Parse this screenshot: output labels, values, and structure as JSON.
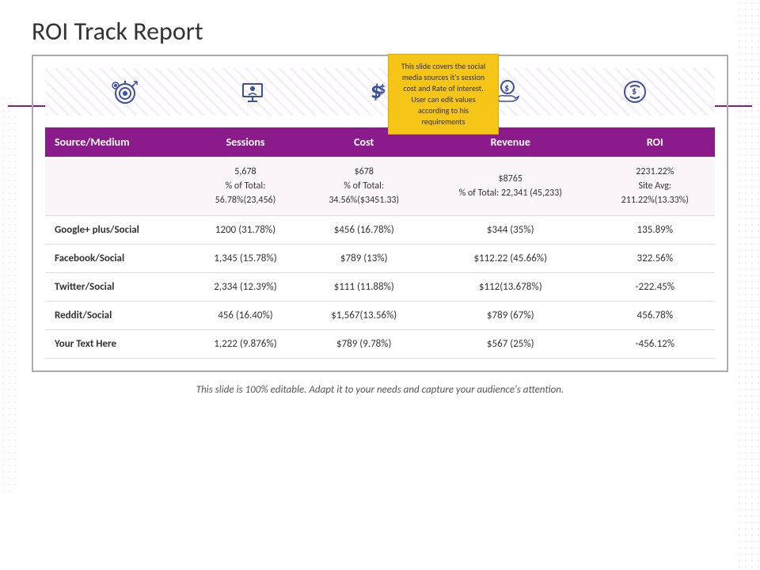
{
  "page": {
    "title": "ROI Track Report",
    "bottom_text": "This slide is 100% editable. Adapt it to your needs and capture your audience's attention."
  },
  "tooltip": {
    "text": "This slide covers the social media sources it's session cost and Rate of interest. User can edit values according to his requirements"
  },
  "icons": [
    {
      "name": "target-icon",
      "label": "Target"
    },
    {
      "name": "presentation-icon",
      "label": "Presentation"
    },
    {
      "name": "cost-icon",
      "label": "Cost"
    },
    {
      "name": "hand-coin-icon",
      "label": "Revenue"
    },
    {
      "name": "roi-icon",
      "label": "ROI"
    }
  ],
  "table": {
    "headers": [
      "Source/Medium",
      "Sessions",
      "Cost",
      "Revenue",
      "ROI"
    ],
    "rows": [
      {
        "source": "",
        "sessions": "5,678\n% of Total:\n56.78%(23,456)",
        "cost": "$678\n% of Total:\n34.56%($3451.33)",
        "revenue": "$8765\n% of Total: 22,341 (45,233)",
        "roi": "2231.22%\nSite Avg:\n211.22%(13.33%)"
      },
      {
        "source": "Google+ plus/Social",
        "sessions": "1200 (31.78%)",
        "cost": "$456 (16.78%)",
        "revenue": "$344 (35%)",
        "roi": "135.89%"
      },
      {
        "source": "Facebook/Social",
        "sessions": "1,345 (15.78%)",
        "cost": "$789 (13%)",
        "revenue": "$112.22 (45.66%)",
        "roi": "322.56%"
      },
      {
        "source": "Twitter/Social",
        "sessions": "2,334 (12.39%)",
        "cost": "$111 (11.88%)",
        "revenue": "$112(13.678%)",
        "roi": "-222.45%"
      },
      {
        "source": "Reddit/Social",
        "sessions": "456 (16.40%)",
        "cost": "$1,567(13.56%)",
        "revenue": "$789 (67%)",
        "roi": "456.78%"
      },
      {
        "source": "Your Text Here",
        "sessions": "1,222 (9.876%)",
        "cost": "$789 (9.78%)",
        "revenue": "$567 (25%)",
        "roi": "-456.12%"
      }
    ]
  },
  "colors": {
    "header_bg": "#8b1a8b",
    "header_text": "#ffffff",
    "accent": "#3d4fa0",
    "tooltip_bg": "#f5c518"
  }
}
